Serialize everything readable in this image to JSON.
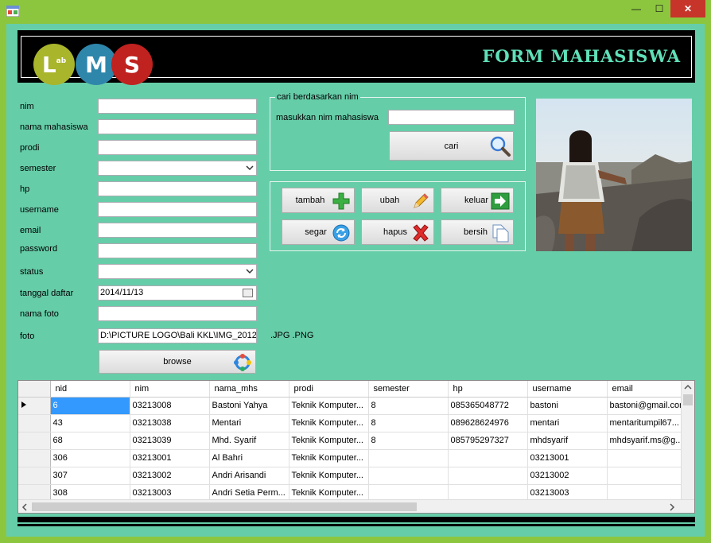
{
  "window": {
    "min": "—",
    "max": "☐",
    "close": "✕"
  },
  "banner": {
    "logo_l": "L",
    "logo_l_sub": "ab",
    "logo_m": "M",
    "logo_s": "S",
    "title": "FORM MAHASISWA"
  },
  "form": {
    "nim_label": "nim",
    "nama_label": "nama mahasiswa",
    "prodi_label": "prodi",
    "semester_label": "semester",
    "hp_label": "hp",
    "username_label": "username",
    "email_label": "email",
    "password_label": "password",
    "status_label": "status",
    "tanggal_label": "tanggal daftar",
    "tanggal_value": "2014/11/13",
    "nama_foto_label": "nama foto",
    "foto_label": "foto",
    "foto_value": "D:\\PICTURE LOGO\\Bali KKL\\IMG_2012",
    "ext_hint": ".JPG  .PNG",
    "browse_label": "browse"
  },
  "search": {
    "legend": "cari berdasarkan nim",
    "label": "masukkan nim mahasiswa",
    "button": "cari"
  },
  "actions": {
    "tambah": "tambah",
    "ubah": "ubah",
    "keluar": "keluar",
    "segar": "segar",
    "hapus": "hapus",
    "bersih": "bersih"
  },
  "table": {
    "columns": [
      "nid",
      "nim",
      "nama_mhs",
      "prodi",
      "semester",
      "hp",
      "username",
      "email"
    ],
    "rows": [
      [
        "6",
        "03213008",
        "Bastoni Yahya",
        "Teknik Komputer...",
        "8",
        "085365048772",
        "bastoni",
        "bastoni@gmail.com"
      ],
      [
        "43",
        "03213038",
        "Mentari",
        "Teknik Komputer...",
        "8",
        "089628624976",
        "mentari",
        "mentaritumpil67..."
      ],
      [
        "68",
        "03213039",
        "Mhd. Syarif",
        "Teknik Komputer...",
        "8",
        "085795297327",
        "mhdsyarif",
        "mhdsyarif.ms@g..."
      ],
      [
        "306",
        "03213001",
        "Al Bahri",
        "Teknik Komputer...",
        "",
        "",
        "03213001",
        ""
      ],
      [
        "307",
        "03213002",
        "Andri Arisandi",
        "Teknik Komputer...",
        "",
        "",
        "03213002",
        ""
      ],
      [
        "308",
        "03213003",
        "Andri Setia Perm...",
        "Teknik Komputer...",
        "",
        "",
        "03213003",
        ""
      ]
    ]
  },
  "colors": {
    "window_border": "#8cc63f",
    "form_bg": "#66cda9",
    "title_color": "#5fe0b8",
    "selection": "#3399ff"
  }
}
